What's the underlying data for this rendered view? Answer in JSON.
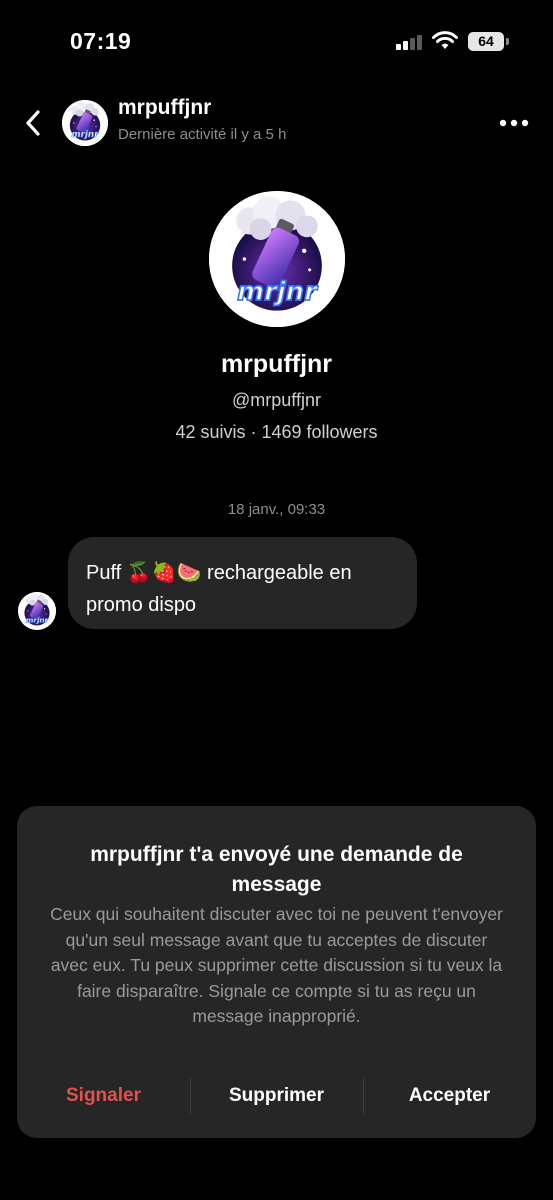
{
  "status_bar": {
    "time": "07:19",
    "battery": "64",
    "icons": [
      "signal-icon",
      "wifi-icon",
      "battery-icon"
    ]
  },
  "header": {
    "back_icon": "chevron-left-icon",
    "name": "mrpuffjnr",
    "activity": "Dernière activité il y a 5 h",
    "more_icon": "more-horizontal-icon"
  },
  "profile": {
    "logo_text": "mrjnr",
    "name": "mrpuffjnr",
    "handle": "@mrpuffjnr",
    "stats": "42 suivis · 1469 followers"
  },
  "conversation": {
    "timestamp": "18 janv., 09:33",
    "message": "Puff 🍒🍓🍉 rechargeable en promo dispo"
  },
  "request_card": {
    "title": "mrpuffjnr t'a envoyé une demande de message",
    "body": "Ceux qui souhaitent discuter avec toi ne peuvent t'envoyer qu'un seul message avant que tu acceptes de discuter avec eux. Tu peux supprimer cette discussion si tu veux la faire disparaître. Signale ce compte si tu as reçu un message inapproprié.",
    "report_label": "Signaler",
    "delete_label": "Supprimer",
    "accept_label": "Accepter"
  },
  "colors": {
    "background": "#000000",
    "surface": "#262626",
    "report": "#e2514a",
    "secondary_text": "#8e8e93"
  }
}
